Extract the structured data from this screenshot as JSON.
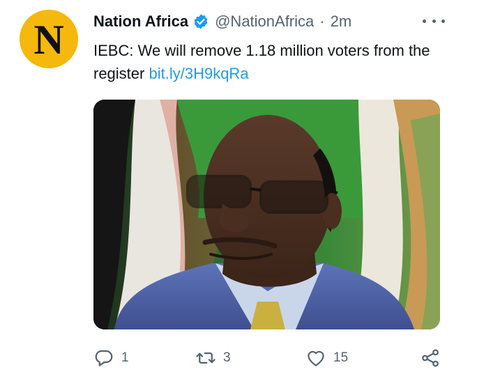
{
  "tweet": {
    "avatar_letter": "N",
    "display_name": "Nation Africa",
    "handle": "@NationAfrica",
    "separator": "·",
    "time": "2m",
    "text_main": "IEBC: We will remove 1.18 million voters from the register ",
    "link": "bit.ly/3H9kqRa"
  },
  "actions": {
    "reply_count": "1",
    "retweet_count": "3",
    "like_count": "15"
  },
  "colors": {
    "avatar_bg": "#f5b80c",
    "link": "#1d9bf0",
    "verified": "#1d9bf0",
    "muted": "#536471"
  },
  "icons": {
    "verified": "verified-badge-icon",
    "more": "more-dots-icon",
    "reply": "reply-icon",
    "retweet": "retweet-icon",
    "like": "heart-icon",
    "share": "share-icon"
  }
}
